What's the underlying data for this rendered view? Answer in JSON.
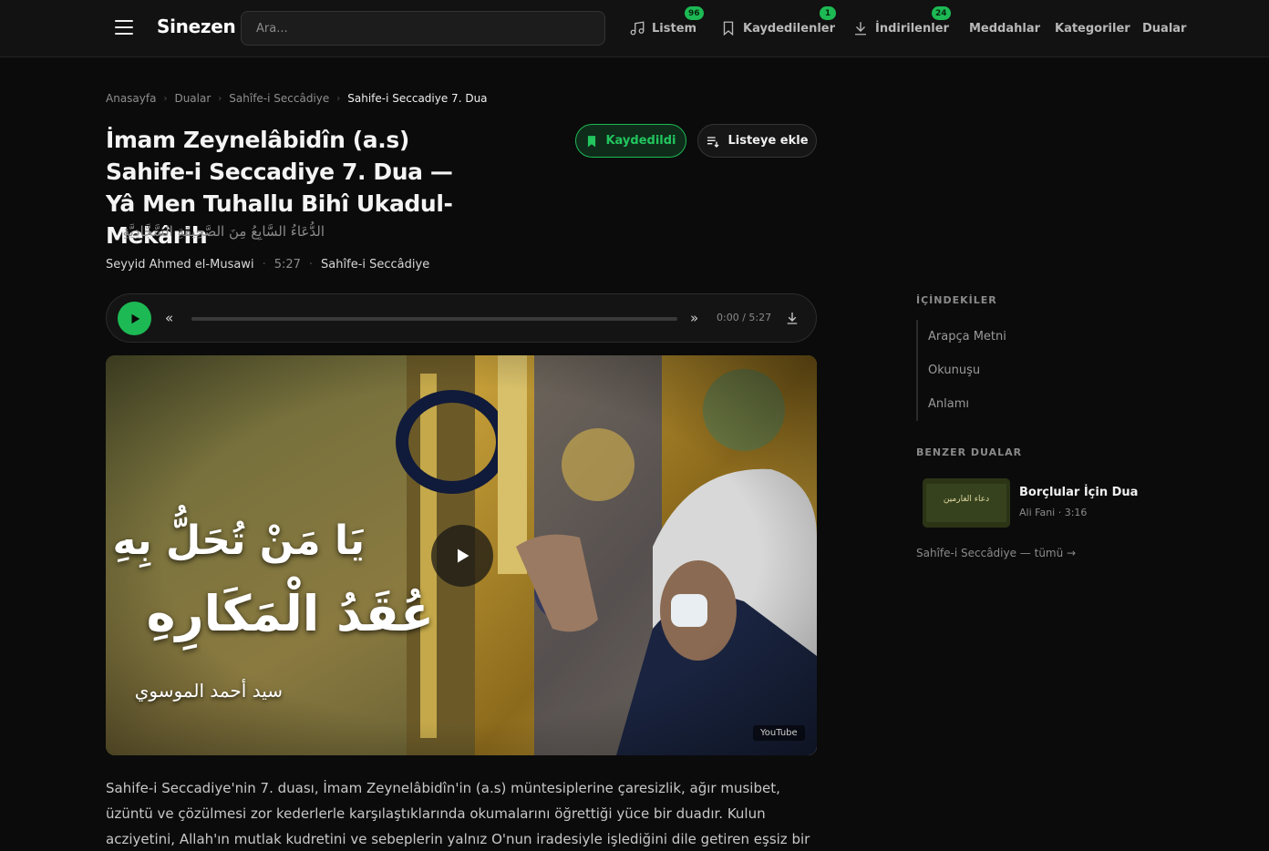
{
  "header": {
    "logo": "Sinezen",
    "search_placeholder": "Ara...",
    "nav": [
      {
        "label": "Listem",
        "badge": "96",
        "icon": "music-note-icon"
      },
      {
        "label": "Kaydedilenler",
        "badge": "1",
        "icon": "bookmark-icon"
      },
      {
        "label": "İndirilenler",
        "badge": "24",
        "icon": "download-icon"
      },
      {
        "label": "Meddahlar"
      },
      {
        "label": "Kategoriler"
      },
      {
        "label": "Dualar"
      }
    ]
  },
  "breadcrumb": [
    "Anasayfa",
    "Dualar",
    "Sahîfe-i Seccâdiye",
    "Sahife-i Seccadiye 7. Dua"
  ],
  "page": {
    "title": "İmam Zeynelâbidîn (a.s) Sahife-i Seccadiye 7. Dua — Yâ Men Tuhallu Bihî Ukadul-Mekârih",
    "arabic_subtitle": "الدُّعَاءُ السَّابِعُ مِنَ الصَّحِيفَةِ السَّجَّادِيَّةِ",
    "reciter": "Seyyid Ahmed el-Musawi",
    "duration": "5:27",
    "collection": "Sahîfe-i Seccâdiye",
    "saved_button": "Kaydedildi",
    "add_list_button": "Listeye ekle"
  },
  "player": {
    "time": "0:00 / 5:27",
    "progress": 0,
    "accent": "#1db954"
  },
  "video": {
    "line1": "يَا مَنْ تُحَلُّ بِهِ",
    "line2": "عُقَدُ الْمَكَارِهِ",
    "line3": "سيد أحمد الموسوي",
    "platform": "YouTube"
  },
  "description": "Sahife-i Seccadiye'nin 7. duası, İmam Zeynelâbidîn'in (a.s) müntesiplerine çaresizlik, ağır musibet, üzüntü ve çözülmesi zor kederlerle karşılaştıklarında okumalarını öğrettiği yüce bir duadır. Kulun acziyetini, Allah'ın mutlak kudretini ve sebeplerin yalnız O'nun iradesiyle işlediğini dile getiren eşsiz bir münacattır.",
  "sidebar": {
    "toc_heading": "İÇİNDEKİLER",
    "toc": [
      "Arapça Metni",
      "Okunuşu",
      "Anlamı"
    ],
    "similar_heading": "BENZER DUALAR",
    "similar": [
      {
        "title": "Borçlular İçin Dua",
        "meta": "Ali Fani · 3:16",
        "thumb_text": "دعاء الغارمين"
      }
    ],
    "all_link": "Sahîfe-i Seccâdiye — tümü →"
  }
}
